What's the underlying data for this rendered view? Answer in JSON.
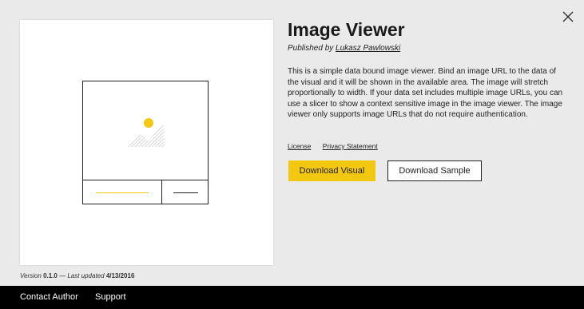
{
  "dialog": {
    "close_icon": "close-icon"
  },
  "visual": {
    "title": "Image Viewer",
    "published_by_prefix": "Published by",
    "author": "Lukasz Pawlowski",
    "description": "This is a simple data bound image viewer. Bind an image URL to the data of the visual and it will be shown in the available area. The image will stretch proportionally to width. If your data set includes multiple image URLs, you can use a slicer to show a context sensitive image in the image viewer. The image viewer only supports image URLs that do not require authentication.",
    "license_label": "License",
    "privacy_label": "Privacy Statement",
    "download_visual_label": "Download Visual",
    "download_sample_label": "Download Sample",
    "accent_color": "#f2c811"
  },
  "version_info": {
    "version_prefix": "Version",
    "version": "0.1.0",
    "updated_prefix": "— Last updated",
    "updated_date": "4/13/2016"
  },
  "footer": {
    "contact_label": "Contact Author",
    "support_label": "Support"
  }
}
